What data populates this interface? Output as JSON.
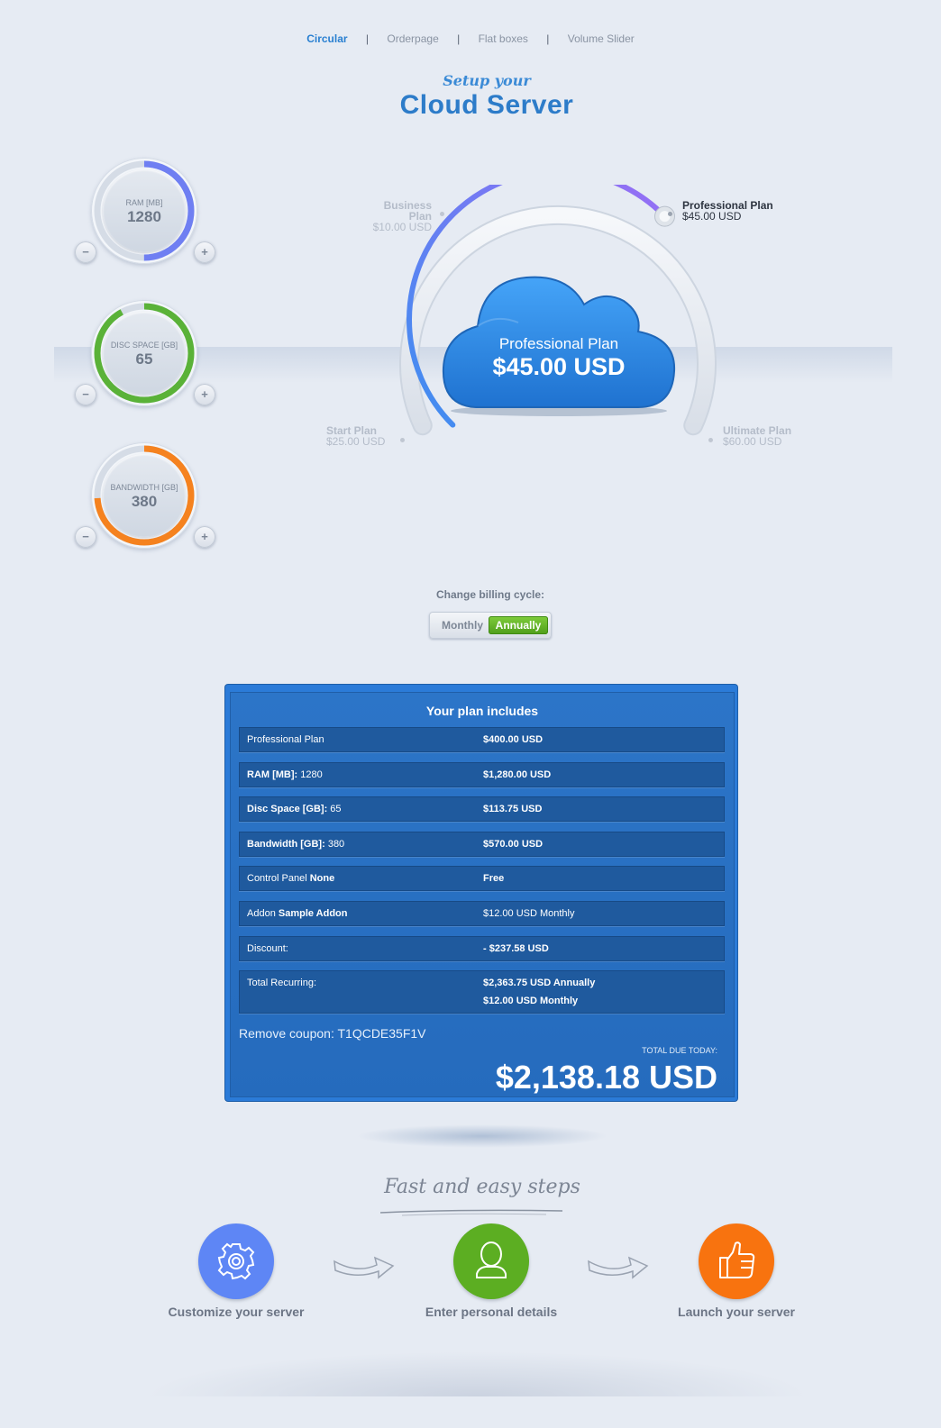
{
  "nav": {
    "items": [
      "Circular",
      "Orderpage",
      "Flat boxes",
      "Volume Slider"
    ],
    "separator": "|"
  },
  "header": {
    "subtitle": "Setup your",
    "title": "Cloud Server"
  },
  "dials": [
    {
      "label": "RAM [MB]",
      "value": "1280",
      "fill_fraction": 0.5,
      "color": "#6f7ff2",
      "minus": "−",
      "plus": "+"
    },
    {
      "label": "DISC SPACE [GB]",
      "value": "65",
      "fill_fraction": 0.92,
      "color": "#5ab238",
      "minus": "−",
      "plus": "+"
    },
    {
      "label": "BANDWIDTH [GB]",
      "value": "380",
      "fill_fraction": 0.74,
      "color": "#f5821f",
      "minus": "−",
      "plus": "+"
    }
  ],
  "plans": [
    {
      "name": "Start Plan",
      "price": "$25.00 USD",
      "active": false
    },
    {
      "name": "Business Plan",
      "price": "$10.00 USD",
      "active": false
    },
    {
      "name": "Professional Plan",
      "price": "$45.00 USD",
      "active": true
    },
    {
      "name": "Ultimate Plan",
      "price": "$60.00 USD",
      "active": false
    }
  ],
  "selected_plan": {
    "name": "Professional Plan",
    "price": "$45.00 USD",
    "slider_fraction": 0.67
  },
  "billing": {
    "label": "Change billing cycle:",
    "options": [
      "Monthly",
      "Annually"
    ],
    "selected": "Annually"
  },
  "summary": {
    "heading": "Your plan includes",
    "rows": [
      {
        "label": "Professional Plan",
        "label_strong": "",
        "label_value": "",
        "price": "$400.00 USD"
      },
      {
        "label": "",
        "label_strong": "RAM [MB]:",
        "label_value": " 1280",
        "price": "$1,280.00 USD"
      },
      {
        "label": "",
        "label_strong": "Disc Space [GB]:",
        "label_value": " 65",
        "price": "$113.75 USD"
      },
      {
        "label": "",
        "label_strong": "Bandwidth [GB]:",
        "label_value": " 380",
        "price": "$570.00 USD"
      },
      {
        "label": "Control Panel ",
        "label_strong": "None",
        "label_value": "",
        "price": "Free"
      },
      {
        "label": "Addon ",
        "label_strong": "Sample Addon",
        "label_value": "",
        "price": "$12.00 USD Monthly"
      },
      {
        "label": "Discount:",
        "label_strong": "",
        "label_value": "",
        "price": "- $237.58 USD"
      }
    ],
    "total_recurring": {
      "label": "Total Recurring:",
      "annual": "$2,363.75 USD Annually",
      "monthly": "$12.00 USD Monthly"
    },
    "coupon": "Remove coupon: T1QCDE35F1V",
    "due_label": "TOTAL DUE TODAY:",
    "due": "$2,138.18 USD"
  },
  "steps": {
    "title": "Fast and easy steps",
    "items": [
      {
        "label": "Customize your server",
        "icon": "gear-icon",
        "color": "#5e86f5"
      },
      {
        "label": "Enter personal details",
        "icon": "user-icon",
        "color": "#5cae22"
      },
      {
        "label": "Launch your server",
        "icon": "thumbs-up-icon",
        "color": "#f8730f"
      }
    ]
  }
}
